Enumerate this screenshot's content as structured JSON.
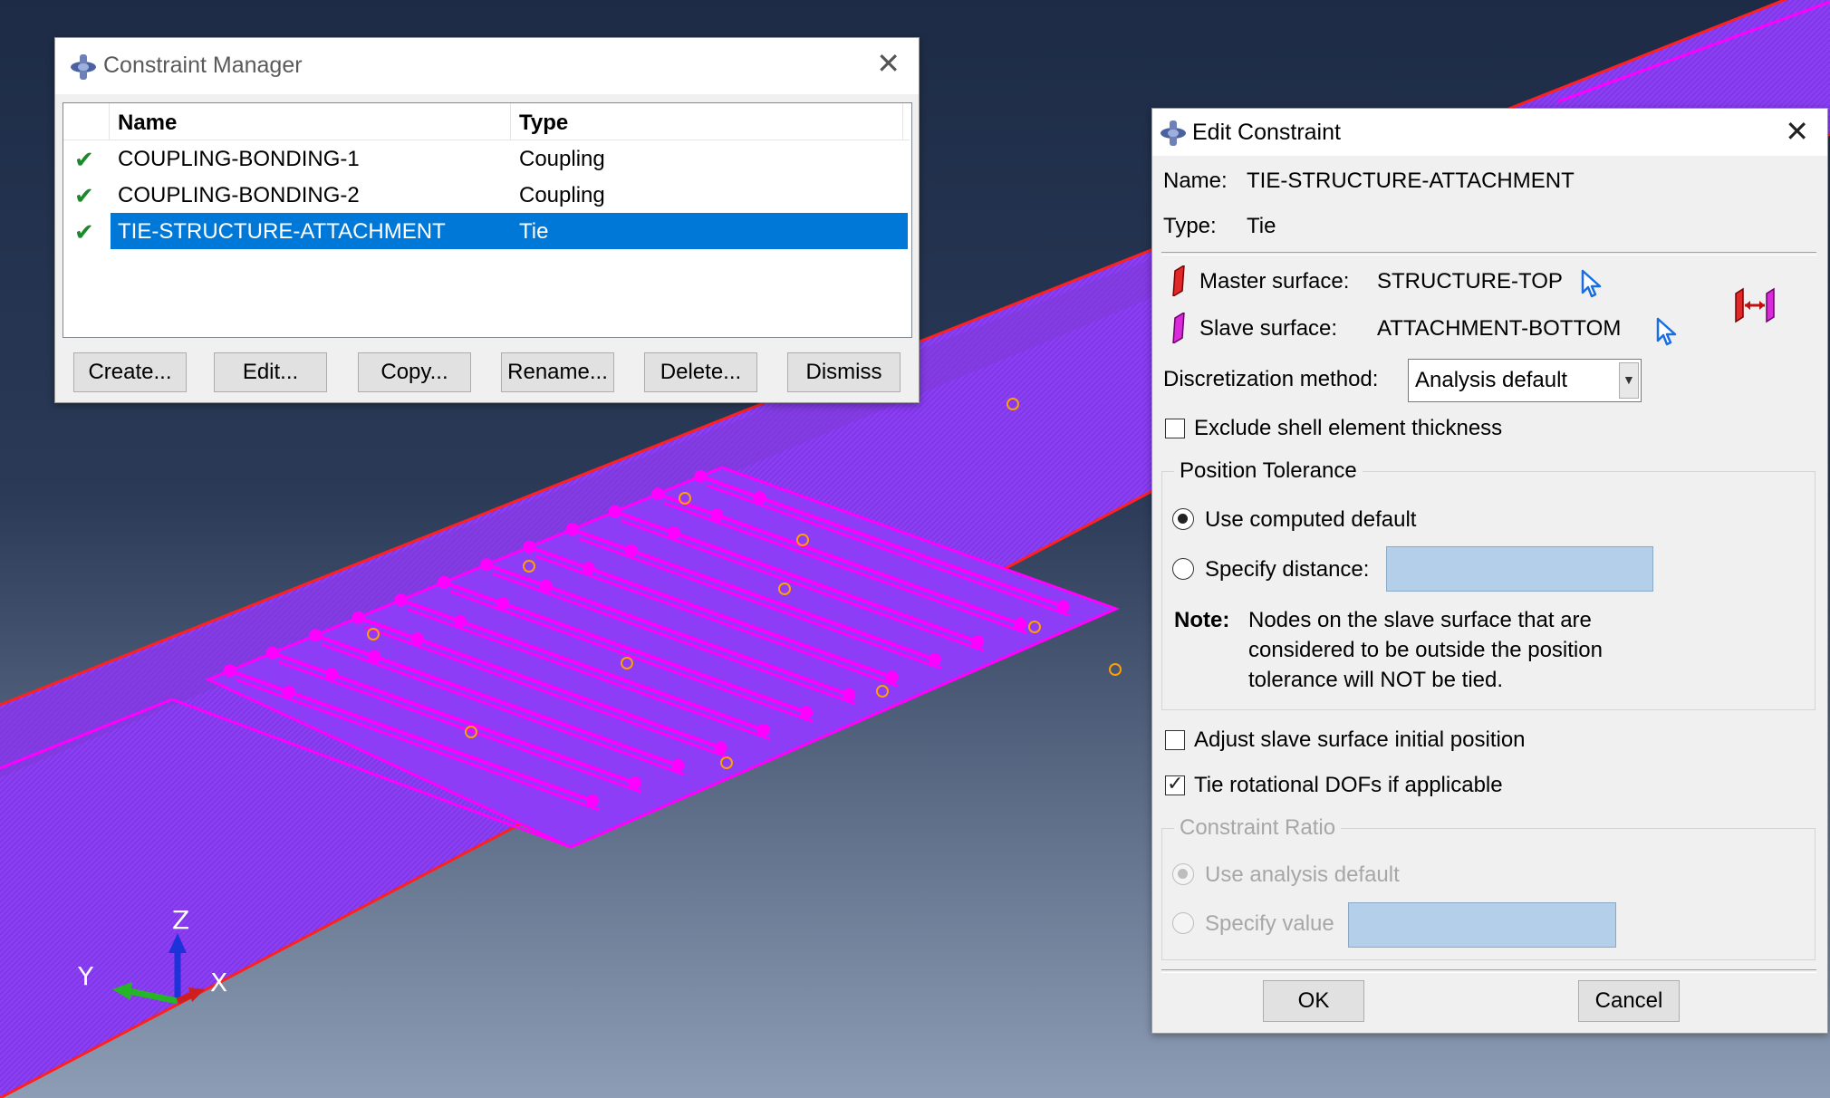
{
  "constraint_manager": {
    "title": "Constraint Manager",
    "columns": {
      "name": "Name",
      "type": "Type"
    },
    "rows": [
      {
        "name": "COUPLING-BONDING-1",
        "type": "Coupling"
      },
      {
        "name": "COUPLING-BONDING-2",
        "type": "Coupling"
      },
      {
        "name": "TIE-STRUCTURE-ATTACHMENT",
        "type": "Tie"
      }
    ],
    "selected_row": 2,
    "buttons": {
      "create": "Create...",
      "edit": "Edit...",
      "copy": "Copy...",
      "rename": "Rename...",
      "delete": "Delete...",
      "dismiss": "Dismiss"
    }
  },
  "edit_constraint": {
    "title": "Edit Constraint",
    "name_label": "Name:",
    "name_value": "TIE-STRUCTURE-ATTACHMENT",
    "type_label": "Type:",
    "type_value": "Tie",
    "master_label": "Master surface:",
    "master_value": "STRUCTURE-TOP",
    "slave_label": "Slave surface:",
    "slave_value": "ATTACHMENT-BOTTOM",
    "discretization_label": "Discretization method:",
    "discretization_value": "Analysis default",
    "exclude_shell_label": "Exclude shell element thickness",
    "exclude_shell_checked": false,
    "position_tolerance": {
      "title": "Position Tolerance",
      "use_computed_label": "Use computed default",
      "specify_distance_label": "Specify distance:",
      "selected": "use_computed",
      "note_label": "Note:",
      "note_lines": [
        "Nodes on the slave surface that are",
        "considered to be outside the position",
        "tolerance will NOT be tied."
      ]
    },
    "adjust_slave_label": "Adjust slave surface initial position",
    "adjust_slave_checked": false,
    "tie_rotational_label": "Tie rotational DOFs if applicable",
    "tie_rotational_checked": true,
    "constraint_ratio": {
      "title": "Constraint Ratio",
      "use_analysis_label": "Use analysis default",
      "specify_value_label": "Specify value",
      "selected": "use_analysis"
    },
    "ok_label": "OK",
    "cancel_label": "Cancel"
  },
  "triad": {
    "z": "Z",
    "y": "Y",
    "x": "X"
  },
  "colors": {
    "viewport_top": "#1d2b46",
    "viewport_bottom": "#8d9db5",
    "model_fill": "#8c3df5",
    "model_edge": "#ff2020",
    "highlight": "#ff00ff",
    "node_marker": "#ffa000",
    "selection_blue": "#0078d7"
  }
}
